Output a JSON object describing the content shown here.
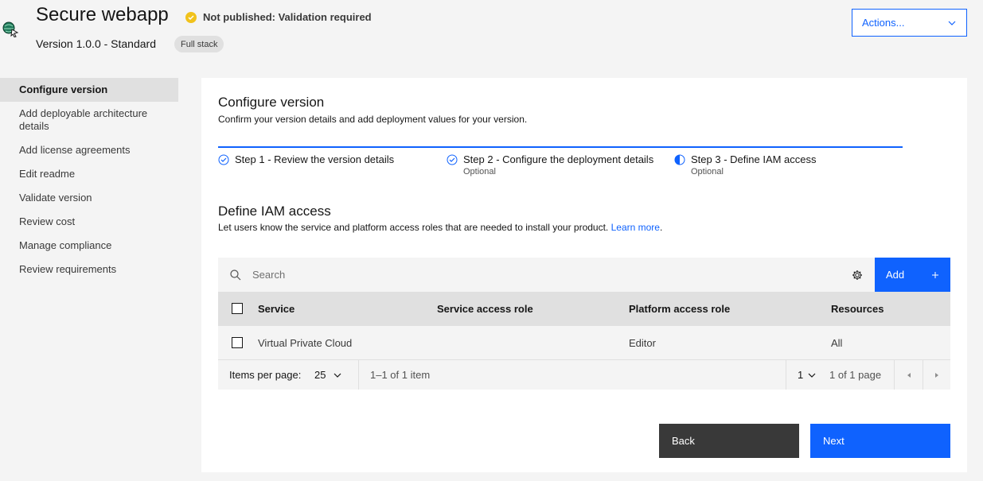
{
  "header": {
    "title": "Secure webapp",
    "status": "Not published: Validation required",
    "version": "Version 1.0.0 - Standard",
    "tag": "Full stack",
    "actions_label": "Actions..."
  },
  "sidebar": {
    "items": [
      {
        "label": "Configure version",
        "active": true
      },
      {
        "label": "Add deployable architecture details"
      },
      {
        "label": "Add license agreements"
      },
      {
        "label": "Edit readme"
      },
      {
        "label": "Validate version"
      },
      {
        "label": "Review cost"
      },
      {
        "label": "Manage compliance"
      },
      {
        "label": "Review requirements"
      }
    ]
  },
  "main": {
    "title": "Configure version",
    "description": "Confirm your version details and add deployment values for your version.",
    "steps": [
      {
        "label": "Step 1 - Review the version details",
        "sub": "",
        "state": "complete"
      },
      {
        "label": "Step 2 - Configure the deployment details",
        "sub": "Optional",
        "state": "complete"
      },
      {
        "label": "Step 3 - Define IAM access",
        "sub": "Optional",
        "state": "current"
      }
    ],
    "iam": {
      "title": "Define IAM access",
      "description": "Let users know the service and platform access roles that are needed to install your product.",
      "link": "Learn more",
      "period": "."
    },
    "table": {
      "search_placeholder": "Search",
      "add_label": "Add",
      "columns": [
        "Service",
        "Service access role",
        "Platform access role",
        "Resources"
      ],
      "rows": [
        {
          "service": "Virtual Private Cloud",
          "service_role": "",
          "platform_role": "Editor",
          "resources": "All"
        }
      ],
      "pagination": {
        "items_per_page_label": "Items per page:",
        "items_per_page": "25",
        "range": "1–1 of 1 item",
        "page": "1",
        "page_of": "1 of 1 page"
      }
    },
    "buttons": {
      "back": "Back",
      "next": "Next"
    }
  },
  "colors": {
    "accent": "#0f62fe",
    "warning": "#f1c21b",
    "dark_button": "#393939"
  }
}
